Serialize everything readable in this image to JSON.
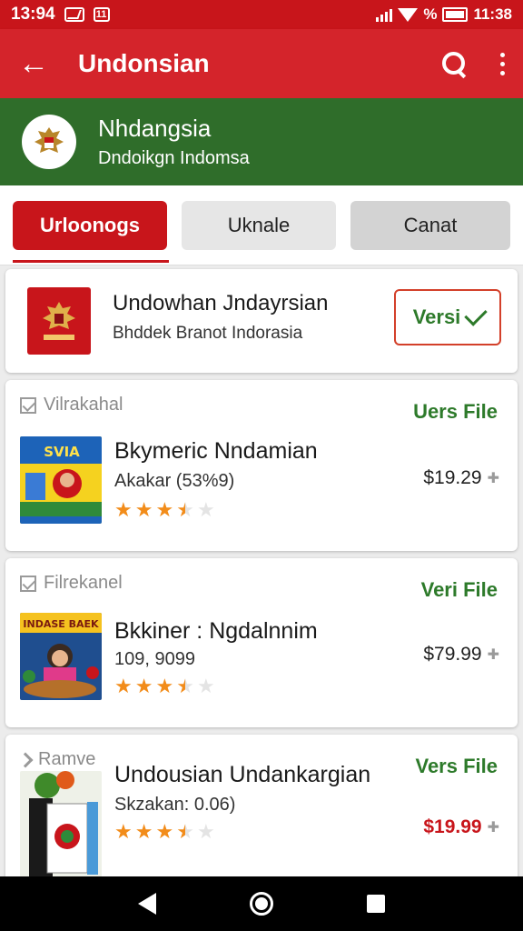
{
  "status_bar": {
    "time_left": "13:94",
    "badge": "11",
    "percent_icon": "%",
    "time_right": "11:38"
  },
  "app_bar": {
    "title": "Undonsian",
    "back_icon": "arrow-left-icon",
    "search_icon": "search-icon",
    "menu_icon": "more-vert-icon"
  },
  "banner": {
    "title": "Nhdangsia",
    "subtitle": "Dndoikgn Indomsa"
  },
  "tabs": [
    {
      "label": "Urloonogs",
      "active": true
    },
    {
      "label": "Uknale",
      "active": false
    },
    {
      "label": "Canat",
      "active": false
    }
  ],
  "featured": {
    "title": "Undowhan Jndayrsian",
    "subtitle": "Bhddek Branot Indorasia",
    "action_label": "Versi"
  },
  "items": [
    {
      "category": "Vilrakahal",
      "file_label": "Uers File",
      "title": "Bkymeric Nndamian",
      "subtitle": "Akakar (53%9)",
      "rating": 3.5,
      "price": "$19.29",
      "thumb_text": "SVIA"
    },
    {
      "category": "Filrekanel",
      "file_label": "Veri File",
      "title": "Bkkiner :  Ngdalnnim",
      "subtitle": "109, 9099",
      "rating": 3.5,
      "price": "$79.99",
      "thumb_text": "INDASE BAEK"
    },
    {
      "category": "Ramve",
      "file_label": "Vers File",
      "title": "Undousian Undankargian",
      "subtitle": "Skzakan: 0.06)",
      "rating": 3.5,
      "price": "$19.99"
    }
  ],
  "colors": {
    "red": "#c8151b",
    "green": "#2f6d2a",
    "star": "#f28c1a"
  }
}
